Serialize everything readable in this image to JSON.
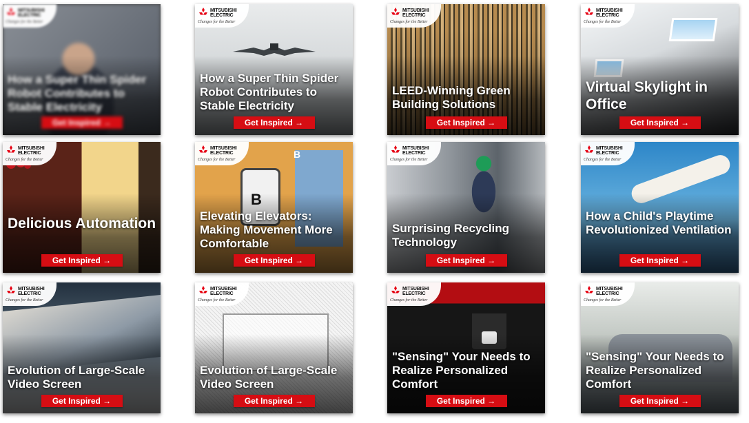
{
  "brand": {
    "name": "MITSUBISHI ELECTRIC",
    "tagline": "Changes for the Better",
    "red": "#d60d13"
  },
  "cards": [
    {
      "title": "How a Super Thin Spider Robot Contributes to Stable Electricity",
      "cta": "Get Inspired →",
      "blurred": true
    },
    {
      "title": "How a Super Thin Spider Robot Contributes to Stable Electricity",
      "cta": "Get Inspired →"
    },
    {
      "title": "LEED-Winning Green Building Solutions",
      "cta": "Get Inspired →"
    },
    {
      "title": "Virtual Skylight in Office",
      "cta": "Get Inspired →"
    },
    {
      "title": "Delicious Automation",
      "cta": "Get Inspired →"
    },
    {
      "title": "Elevating Elevators: Making Movement More Comfortable",
      "cta": "Get Inspired →"
    },
    {
      "title": "Surprising Recycling Technology",
      "cta": "Get Inspired →"
    },
    {
      "title": "How a Child's Playtime Revolutionized Ventilation",
      "cta": "Get Inspired →"
    },
    {
      "title": "Evolution of Large-Scale Video Screen",
      "cta": "Get Inspired →"
    },
    {
      "title": "Evolution of Large-Scale Video Screen",
      "cta": "Get Inspired →"
    },
    {
      "title": "\"Sensing\" Your Needs to Realize Personalized Comfort",
      "cta": "Get Inspired →"
    },
    {
      "title": "\"Sensing\" Your Needs to Realize Personalized Comfort",
      "cta": "Get Inspired →"
    }
  ],
  "scene_text": {
    "elevator_letter": "B",
    "phone_letter": "B"
  }
}
